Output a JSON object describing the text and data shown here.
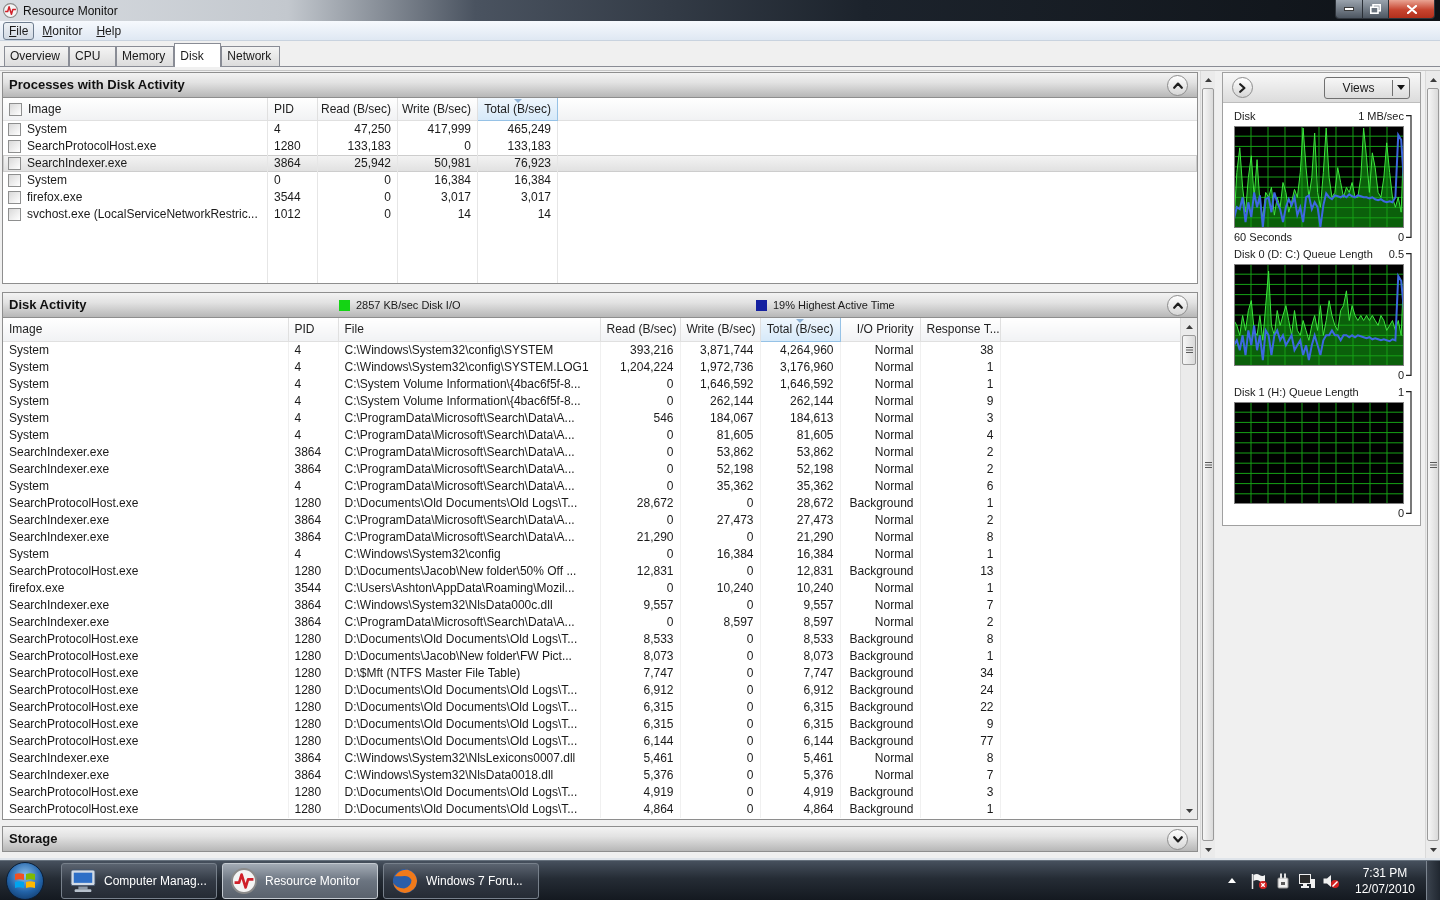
{
  "window": {
    "title": "Resource Monitor"
  },
  "menu": [
    {
      "label": "File",
      "selected": true
    },
    {
      "label": "Monitor",
      "selected": false
    },
    {
      "label": "Help",
      "selected": false
    }
  ],
  "tabs": [
    {
      "label": "Overview",
      "selected": false
    },
    {
      "label": "CPU",
      "selected": false
    },
    {
      "label": "Memory",
      "selected": false
    },
    {
      "label": "Disk",
      "selected": true
    },
    {
      "label": "Network",
      "selected": false
    }
  ],
  "processes": {
    "title": "Processes with Disk Activity",
    "expanded": true,
    "select_all_checked": false,
    "columns": [
      {
        "label": "Image",
        "sorted": false
      },
      {
        "label": "PID",
        "sorted": false
      },
      {
        "label": "Read (B/sec)",
        "sorted": false
      },
      {
        "label": "Write (B/sec)",
        "sorted": false
      },
      {
        "label": "Total (B/sec)",
        "sorted": true
      }
    ],
    "rows": [
      {
        "cells": [
          "System",
          "4",
          "47,250",
          "417,999",
          "465,249"
        ],
        "checked": false,
        "selected": false
      },
      {
        "cells": [
          "SearchProtocolHost.exe",
          "1280",
          "133,183",
          "0",
          "133,183"
        ],
        "checked": false,
        "selected": false
      },
      {
        "cells": [
          "SearchIndexer.exe",
          "3864",
          "25,942",
          "50,981",
          "76,923"
        ],
        "checked": false,
        "selected": true
      },
      {
        "cells": [
          "System",
          "0",
          "0",
          "16,384",
          "16,384"
        ],
        "checked": false,
        "selected": false
      },
      {
        "cells": [
          "firefox.exe",
          "3544",
          "0",
          "3,017",
          "3,017"
        ],
        "checked": false,
        "selected": false
      },
      {
        "cells": [
          "svchost.exe (LocalServiceNetworkRestric...",
          "1012",
          "0",
          "14",
          "14"
        ],
        "checked": false,
        "selected": false
      }
    ]
  },
  "disk_activity": {
    "title": "Disk Activity",
    "expanded": true,
    "indicators": [
      {
        "text": "2857 KB/sec Disk I/O",
        "color": "#14d414"
      },
      {
        "text": "19% Highest Active Time",
        "color": "#1420a0"
      }
    ],
    "columns": [
      {
        "label": "Image",
        "sorted": false
      },
      {
        "label": "PID",
        "sorted": false
      },
      {
        "label": "File",
        "sorted": false
      },
      {
        "label": "Read (B/sec)",
        "sorted": false
      },
      {
        "label": "Write (B/sec)",
        "sorted": false
      },
      {
        "label": "Total (B/sec)",
        "sorted": true
      },
      {
        "label": "I/O Priority",
        "sorted": false
      },
      {
        "label": "Response T...",
        "sorted": false
      }
    ],
    "rows": [
      [
        "System",
        "4",
        "C:\\Windows\\System32\\config\\SYSTEM",
        "393,216",
        "3,871,744",
        "4,264,960",
        "Normal",
        "38"
      ],
      [
        "System",
        "4",
        "C:\\Windows\\System32\\config\\SYSTEM.LOG1",
        "1,204,224",
        "1,972,736",
        "3,176,960",
        "Normal",
        "1"
      ],
      [
        "System",
        "4",
        "C:\\System Volume Information\\{4bac6f5f-8...",
        "0",
        "1,646,592",
        "1,646,592",
        "Normal",
        "1"
      ],
      [
        "System",
        "4",
        "C:\\System Volume Information\\{4bac6f5f-8...",
        "0",
        "262,144",
        "262,144",
        "Normal",
        "9"
      ],
      [
        "System",
        "4",
        "C:\\ProgramData\\Microsoft\\Search\\Data\\A...",
        "546",
        "184,067",
        "184,613",
        "Normal",
        "3"
      ],
      [
        "System",
        "4",
        "C:\\ProgramData\\Microsoft\\Search\\Data\\A...",
        "0",
        "81,605",
        "81,605",
        "Normal",
        "4"
      ],
      [
        "SearchIndexer.exe",
        "3864",
        "C:\\ProgramData\\Microsoft\\Search\\Data\\A...",
        "0",
        "53,862",
        "53,862",
        "Normal",
        "2"
      ],
      [
        "SearchIndexer.exe",
        "3864",
        "C:\\ProgramData\\Microsoft\\Search\\Data\\A...",
        "0",
        "52,198",
        "52,198",
        "Normal",
        "2"
      ],
      [
        "System",
        "4",
        "C:\\ProgramData\\Microsoft\\Search\\Data\\A...",
        "0",
        "35,362",
        "35,362",
        "Normal",
        "6"
      ],
      [
        "SearchProtocolHost.exe",
        "1280",
        "D:\\Documents\\Old Documents\\Old Logs\\T...",
        "28,672",
        "0",
        "28,672",
        "Background",
        "1"
      ],
      [
        "SearchIndexer.exe",
        "3864",
        "C:\\ProgramData\\Microsoft\\Search\\Data\\A...",
        "0",
        "27,473",
        "27,473",
        "Normal",
        "2"
      ],
      [
        "SearchIndexer.exe",
        "3864",
        "C:\\ProgramData\\Microsoft\\Search\\Data\\A...",
        "21,290",
        "0",
        "21,290",
        "Normal",
        "8"
      ],
      [
        "System",
        "4",
        "C:\\Windows\\System32\\config",
        "0",
        "16,384",
        "16,384",
        "Normal",
        "1"
      ],
      [
        "SearchProtocolHost.exe",
        "1280",
        "D:\\Documents\\Jacob\\New folder\\50% Off ...",
        "12,831",
        "0",
        "12,831",
        "Background",
        "13"
      ],
      [
        "firefox.exe",
        "3544",
        "C:\\Users\\Ashton\\AppData\\Roaming\\Mozil...",
        "0",
        "10,240",
        "10,240",
        "Normal",
        "1"
      ],
      [
        "SearchIndexer.exe",
        "3864",
        "C:\\Windows\\System32\\NlsData000c.dll",
        "9,557",
        "0",
        "9,557",
        "Normal",
        "7"
      ],
      [
        "SearchIndexer.exe",
        "3864",
        "C:\\ProgramData\\Microsoft\\Search\\Data\\A...",
        "0",
        "8,597",
        "8,597",
        "Normal",
        "2"
      ],
      [
        "SearchProtocolHost.exe",
        "1280",
        "D:\\Documents\\Old Documents\\Old Logs\\T...",
        "8,533",
        "0",
        "8,533",
        "Background",
        "8"
      ],
      [
        "SearchProtocolHost.exe",
        "1280",
        "D:\\Documents\\Jacob\\New folder\\FW Pict...",
        "8,073",
        "0",
        "8,073",
        "Background",
        "1"
      ],
      [
        "SearchProtocolHost.exe",
        "1280",
        "D:\\$Mft (NTFS Master File Table)",
        "7,747",
        "0",
        "7,747",
        "Background",
        "34"
      ],
      [
        "SearchProtocolHost.exe",
        "1280",
        "D:\\Documents\\Old Documents\\Old Logs\\T...",
        "6,912",
        "0",
        "6,912",
        "Background",
        "24"
      ],
      [
        "SearchProtocolHost.exe",
        "1280",
        "D:\\Documents\\Old Documents\\Old Logs\\T...",
        "6,315",
        "0",
        "6,315",
        "Background",
        "22"
      ],
      [
        "SearchProtocolHost.exe",
        "1280",
        "D:\\Documents\\Old Documents\\Old Logs\\T...",
        "6,315",
        "0",
        "6,315",
        "Background",
        "9"
      ],
      [
        "SearchProtocolHost.exe",
        "1280",
        "D:\\Documents\\Old Documents\\Old Logs\\T...",
        "6,144",
        "0",
        "6,144",
        "Background",
        "77"
      ],
      [
        "SearchIndexer.exe",
        "3864",
        "C:\\Windows\\System32\\NlsLexicons0007.dll",
        "5,461",
        "0",
        "5,461",
        "Normal",
        "8"
      ],
      [
        "SearchIndexer.exe",
        "3864",
        "C:\\Windows\\System32\\NlsData0018.dll",
        "5,376",
        "0",
        "5,376",
        "Normal",
        "7"
      ],
      [
        "SearchProtocolHost.exe",
        "1280",
        "D:\\Documents\\Old Documents\\Old Logs\\T...",
        "4,919",
        "0",
        "4,919",
        "Background",
        "3"
      ],
      [
        "SearchProtocolHost.exe",
        "1280",
        "D:\\Documents\\Old Documents\\Old Logs\\T...",
        "4,864",
        "0",
        "4,864",
        "Background",
        "1"
      ]
    ]
  },
  "storage": {
    "title": "Storage",
    "expanded": false
  },
  "graph_panel": {
    "views_label": "Views",
    "graphs": [
      {
        "title": "Disk",
        "max": "1 MB/sec",
        "span": "60 Seconds",
        "min": "0",
        "active": true
      },
      {
        "title": "Disk 0 (D: C:) Queue Length",
        "max": "0.5",
        "min": "0",
        "active": true
      },
      {
        "title": "Disk 1 (H:) Queue Length",
        "max": "1",
        "min": "0",
        "active": false
      }
    ]
  },
  "taskbar": {
    "buttons": [
      {
        "label": "Computer Manag...",
        "selected": false
      },
      {
        "label": "Resource Monitor",
        "selected": true
      },
      {
        "label": "Windows 7 Foru...",
        "selected": false
      }
    ],
    "clock": {
      "time": "7:31 PM",
      "date": "12/07/2010"
    }
  }
}
